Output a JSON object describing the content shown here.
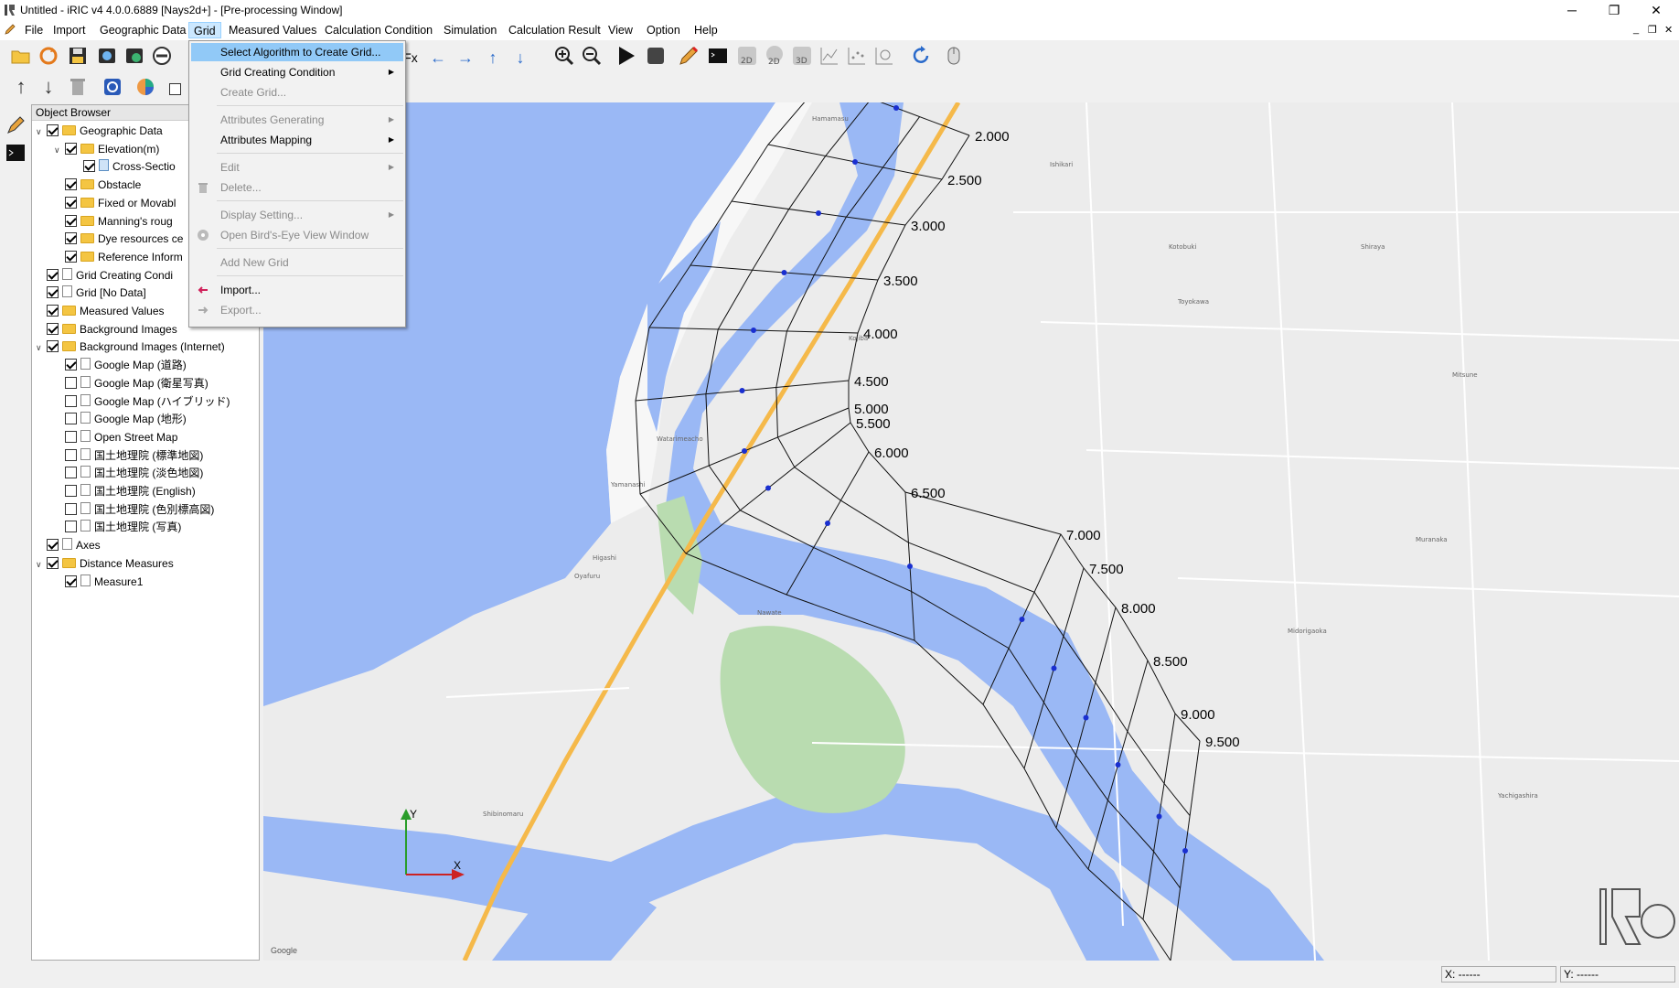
{
  "window": {
    "title": "Untitled - iRIC v4 4.0.0.6889 [Nays2d+] - [Pre-processing Window]",
    "minimize": "─",
    "restore": "❐",
    "close": "✕",
    "mdi_minimize": "_",
    "mdi_restore": "❐",
    "mdi_close": "✕"
  },
  "menubar": [
    "File",
    "Import",
    "Geographic Data",
    "Grid",
    "Measured Values",
    "Calculation Condition",
    "Simulation",
    "Calculation Result",
    "View",
    "Option",
    "Help"
  ],
  "grid_menu": {
    "items": [
      {
        "label": "Select Algorithm to Create Grid...",
        "enabled": true,
        "highlighted": true
      },
      {
        "label": "Grid Creating Condition",
        "enabled": true,
        "submenu": true
      },
      {
        "label": "Create Grid...",
        "enabled": false
      },
      {
        "label": "Attributes Generating",
        "enabled": false,
        "submenu": true
      },
      {
        "label": "Attributes Mapping",
        "enabled": true,
        "submenu": true
      },
      {
        "label": "Edit",
        "enabled": false,
        "submenu": true
      },
      {
        "label": "Delete...",
        "enabled": false
      },
      {
        "label": "Display Setting...",
        "enabled": false,
        "submenu": true
      },
      {
        "label": "Open Bird's-Eye View Window",
        "enabled": false
      },
      {
        "label": "Add New Grid",
        "enabled": false
      },
      {
        "label": "Import...",
        "enabled": true
      },
      {
        "label": "Export...",
        "enabled": false
      }
    ]
  },
  "object_browser": {
    "title": "Object Browser",
    "items": [
      {
        "label": "Geographic Data",
        "checked": true,
        "icon": "folder"
      },
      {
        "label": "Elevation(m)",
        "checked": true,
        "icon": "folder"
      },
      {
        "label": "Cross-Sectio",
        "checked": true,
        "icon": "doc-blue"
      },
      {
        "label": "Obstacle",
        "checked": true,
        "icon": "folder"
      },
      {
        "label": "Fixed or Movabl",
        "checked": true,
        "icon": "folder"
      },
      {
        "label": "Manning's roug",
        "checked": true,
        "icon": "folder"
      },
      {
        "label": "Dye resources ce",
        "checked": true,
        "icon": "folder"
      },
      {
        "label": "Reference Inform",
        "checked": true,
        "icon": "folder"
      },
      {
        "label": "Grid Creating Condi",
        "checked": true,
        "icon": "doc"
      },
      {
        "label": "Grid [No Data]",
        "checked": true,
        "icon": "doc"
      },
      {
        "label": "Measured Values",
        "checked": true,
        "icon": "folder"
      },
      {
        "label": "Background Images",
        "checked": true,
        "icon": "folder"
      },
      {
        "label": "Background Images (Internet)",
        "checked": true,
        "icon": "folder"
      },
      {
        "label": "Google Map (道路)",
        "checked": true,
        "icon": "doc"
      },
      {
        "label": "Google Map (衛星写真)",
        "checked": false,
        "icon": "doc"
      },
      {
        "label": "Google Map (ハイブリッド)",
        "checked": false,
        "icon": "doc"
      },
      {
        "label": "Google Map (地形)",
        "checked": false,
        "icon": "doc"
      },
      {
        "label": "Open Street Map",
        "checked": false,
        "icon": "doc"
      },
      {
        "label": "国土地理院 (標準地図)",
        "checked": false,
        "icon": "doc"
      },
      {
        "label": "国土地理院 (淡色地図)",
        "checked": false,
        "icon": "doc"
      },
      {
        "label": "国土地理院 (English)",
        "checked": false,
        "icon": "doc"
      },
      {
        "label": "国土地理院 (色別標高図)",
        "checked": false,
        "icon": "doc"
      },
      {
        "label": "国土地理院 (写真)",
        "checked": false,
        "icon": "doc"
      },
      {
        "label": "Axes",
        "checked": true,
        "icon": "doc"
      },
      {
        "label": "Distance Measures",
        "checked": true,
        "icon": "folder"
      },
      {
        "label": "Measure1",
        "checked": true,
        "icon": "doc"
      }
    ]
  },
  "map": {
    "section_labels": [
      "2.000",
      "2.500",
      "3.000",
      "3.500",
      "4.000",
      "4.500",
      "5.000",
      "5.500",
      "6.000",
      "6.500",
      "7.000",
      "7.500",
      "8.000",
      "8.500",
      "9.000",
      "9.500"
    ],
    "axis_x": "X",
    "axis_y": "Y",
    "attribution": "Google",
    "places": [
      "Hamamasu",
      "Ishikari",
      "Kotobuki",
      "Toyokawa",
      "Shiraya",
      "Mitsune",
      "Muranaka",
      "Midorigaoka",
      "Kojiba",
      "Higashi",
      "Yamanashi",
      "Nawate",
      "Oyafuru",
      "Watarimeacho",
      "Shibinomaru",
      "Yachigashira"
    ]
  },
  "status": {
    "x": "X: ------",
    "y": "Y: ------"
  },
  "colors": {
    "river": "#9ab8f5",
    "road_major": "#f5b94a",
    "highlight": "#91c9f7"
  }
}
